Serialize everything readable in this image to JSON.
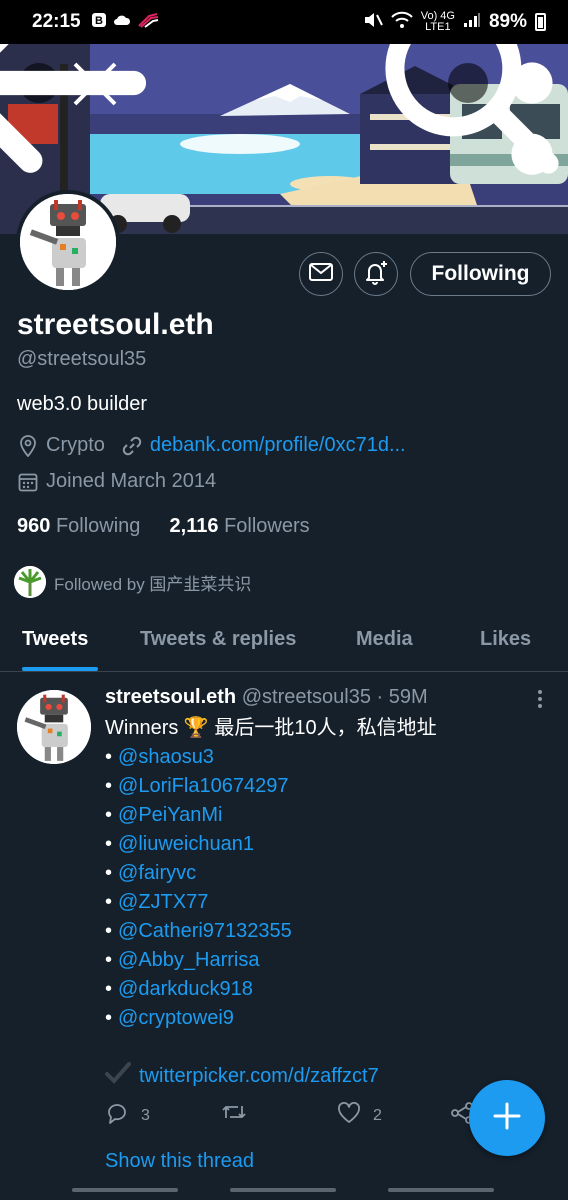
{
  "status_bar": {
    "time": "22:15",
    "network": "Vo) 4G",
    "network_sub": "LTE1",
    "battery": "89%"
  },
  "colors": {
    "background": "#15202b",
    "accent": "#1d9bf0",
    "secondary_text": "#8b98a5",
    "divider": "#38444d"
  },
  "header": {
    "back_icon": "back-arrow-icon",
    "search_icon": "search-icon",
    "more_icon": "more-vertical-icon"
  },
  "profile": {
    "display_name": "streetsoul.eth",
    "handle": "@streetsoul35",
    "bio": "web3.0 builder",
    "location": "Crypto",
    "website": "debank.com/profile/0xc71d...",
    "joined": "Joined March 2014",
    "following_count": "960",
    "following_label": "Following",
    "followers_count": "2,116",
    "followers_label": "Followers",
    "followed_by": "Followed by 国产韭菜共识",
    "follow_button": "Following"
  },
  "tabs": [
    {
      "label": "Tweets",
      "active": true
    },
    {
      "label": "Tweets & replies",
      "active": false
    },
    {
      "label": "Media",
      "active": false
    },
    {
      "label": "Likes",
      "active": false
    }
  ],
  "tweet": {
    "author_name": "streetsoul.eth",
    "author_handle": "@streetsoul35",
    "separator": "·",
    "time": "59M",
    "line1": "Winners 🏆 最后一批10人，私信地址",
    "mentions": [
      "@shaosu3",
      "@LoriFla10674297",
      "@PeiYanMi",
      "@liuweichuan1",
      "@fairyvc",
      "@ZJTX77",
      "@Catheri97132355",
      "@Abby_Harrisa",
      "@darkduck918",
      "@cryptowei9"
    ],
    "bullet": "•",
    "link": "twitterpicker.com/d/zaffzct7",
    "reply_count": "3",
    "like_count": "2",
    "show_thread": "Show this thread"
  }
}
